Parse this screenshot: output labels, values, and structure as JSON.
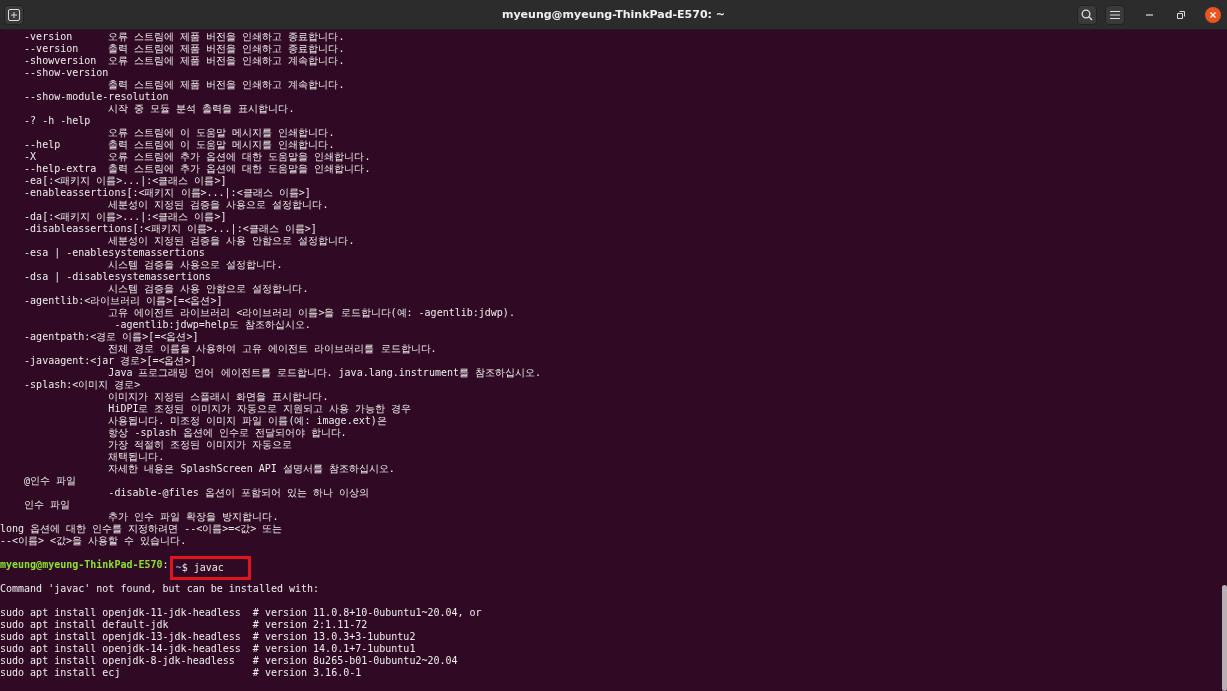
{
  "window": {
    "title": "myeung@myeung-ThinkPad-E570: ~"
  },
  "terminal": {
    "lines": [
      {
        "kind": "text",
        "text": "    -version      오류 스트림에 제품 버전을 인쇄하고 종료합니다."
      },
      {
        "kind": "text",
        "text": "    --version     출력 스트림에 제품 버전을 인쇄하고 종료합니다."
      },
      {
        "kind": "text",
        "text": "    -showversion  오류 스트림에 제품 버전을 인쇄하고 계속합니다."
      },
      {
        "kind": "text",
        "text": "    --show-version"
      },
      {
        "kind": "text",
        "text": "                  출력 스트림에 제품 버전을 인쇄하고 계속합니다."
      },
      {
        "kind": "text",
        "text": "    --show-module-resolution"
      },
      {
        "kind": "text",
        "text": "                  시작 중 모듈 분석 출력을 표시합니다."
      },
      {
        "kind": "text",
        "text": "    -? -h -help"
      },
      {
        "kind": "text",
        "text": "                  오류 스트림에 이 도움말 메시지를 인쇄합니다."
      },
      {
        "kind": "text",
        "text": "    --help        출력 스트림에 이 도움말 메시지를 인쇄합니다."
      },
      {
        "kind": "text",
        "text": "    -X            오류 스트림에 추가 옵션에 대한 도움말을 인쇄합니다."
      },
      {
        "kind": "text",
        "text": "    --help-extra  출력 스트림에 추가 옵션에 대한 도움말을 인쇄합니다."
      },
      {
        "kind": "text",
        "text": "    -ea[:<패키지 이름>...|:<클래스 이름>]"
      },
      {
        "kind": "text",
        "text": "    -enableassertions[:<패키지 이름>...|:<클래스 이름>]"
      },
      {
        "kind": "text",
        "text": "                  세분성이 지정된 검증을 사용으로 설정합니다."
      },
      {
        "kind": "text",
        "text": "    -da[:<패키지 이름>...|:<클래스 이름>]"
      },
      {
        "kind": "text",
        "text": "    -disableassertions[:<패키지 이름>...|:<클래스 이름>]"
      },
      {
        "kind": "text",
        "text": "                  세분성이 지정된 검증을 사용 안함으로 설정합니다."
      },
      {
        "kind": "text",
        "text": "    -esa | -enablesystemassertions"
      },
      {
        "kind": "text",
        "text": "                  시스템 검증을 사용으로 설정합니다."
      },
      {
        "kind": "text",
        "text": "    -dsa | -disablesystemassertions"
      },
      {
        "kind": "text",
        "text": "                  시스템 검증을 사용 안함으로 설정합니다."
      },
      {
        "kind": "text",
        "text": "    -agentlib:<라이브러리 이름>[=<옵션>]"
      },
      {
        "kind": "text",
        "text": "                  고유 에이전트 라이브러리 <라이브러리 이름>을 로드합니다(예: -agentlib:jdwp)."
      },
      {
        "kind": "text",
        "text": "                   -agentlib:jdwp=help도 참조하십시오."
      },
      {
        "kind": "text",
        "text": "    -agentpath:<경로 이름>[=<옵션>]"
      },
      {
        "kind": "text",
        "text": "                  전체 경로 이름을 사용하여 고유 에이전트 라이브러리를 로드합니다."
      },
      {
        "kind": "text",
        "text": "    -javaagent:<jar 경로>[=<옵션>]"
      },
      {
        "kind": "text",
        "text": "                  Java 프로그래밍 언어 에이전트를 로드합니다. java.lang.instrument를 참조하십시오."
      },
      {
        "kind": "text",
        "text": "    -splash:<이미지 경로>"
      },
      {
        "kind": "text",
        "text": "                  이미지가 지정된 스플래시 화면을 표시합니다."
      },
      {
        "kind": "text",
        "text": "                  HiDPI로 조정된 이미지가 자동으로 지원되고 사용 가능한 경우"
      },
      {
        "kind": "text",
        "text": "                  사용됩니다. 미조정 이미지 파일 이름(예: image.ext)은"
      },
      {
        "kind": "text",
        "text": "                  항상 -splash 옵션에 인수로 전달되어야 합니다."
      },
      {
        "kind": "text",
        "text": "                  가장 적절히 조정된 이미지가 자동으로"
      },
      {
        "kind": "text",
        "text": "                  채택됩니다."
      },
      {
        "kind": "text",
        "text": "                  자세한 내용은 SplashScreen API 설명서를 참조하십시오."
      },
      {
        "kind": "text",
        "text": "    @인수 파일"
      },
      {
        "kind": "text",
        "text": "                  -disable-@files 옵션이 포함되어 있는 하나 이상의"
      },
      {
        "kind": "text",
        "text": "    인수 파일"
      },
      {
        "kind": "text",
        "text": "                  추가 인수 파일 확장을 방지합니다."
      },
      {
        "kind": "text",
        "text": "long 옵션에 대한 인수를 지정하려면 --<이름>=<값> 또는"
      },
      {
        "kind": "text",
        "text": "--<이름> <값>을 사용할 수 있습니다."
      },
      {
        "kind": "blank"
      },
      {
        "kind": "prompt",
        "user_host": "myeung@myeung-ThinkPad-E570",
        "separator": ":",
        "path": "~",
        "command": "$ javac",
        "highlighted": true
      },
      {
        "kind": "blank"
      },
      {
        "kind": "text",
        "text": "Command 'javac' not found, but can be installed with:"
      },
      {
        "kind": "blank"
      },
      {
        "kind": "text",
        "text": "sudo apt install openjdk-11-jdk-headless  # version 11.0.8+10-0ubuntu1~20.04, or"
      },
      {
        "kind": "text",
        "text": "sudo apt install default-jdk              # version 2:1.11-72"
      },
      {
        "kind": "text",
        "text": "sudo apt install openjdk-13-jdk-headless  # version 13.0.3+3-1ubuntu2"
      },
      {
        "kind": "text",
        "text": "sudo apt install openjdk-14-jdk-headless  # version 14.0.1+7-1ubuntu1"
      },
      {
        "kind": "text",
        "text": "sudo apt install openjdk-8-jdk-headless   # version 8u265-b01-0ubuntu2~20.04"
      },
      {
        "kind": "text",
        "text": "sudo apt install ecj                      # version 3.16.0-1"
      }
    ]
  }
}
